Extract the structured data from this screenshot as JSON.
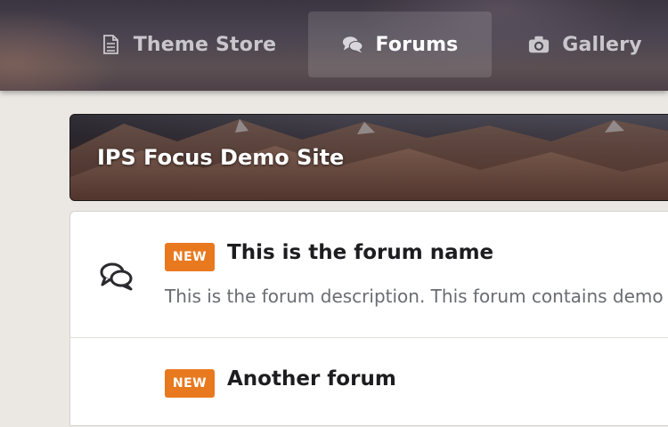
{
  "nav": {
    "items": [
      {
        "label": "Theme Store",
        "icon": "document-icon",
        "active": false
      },
      {
        "label": "Forums",
        "icon": "chat-bubbles-icon",
        "active": true
      },
      {
        "label": "Gallery",
        "icon": "camera-icon",
        "active": false
      }
    ]
  },
  "hero": {
    "title": "IPS Focus Demo Site"
  },
  "forums": [
    {
      "badge": "NEW",
      "name": "This is the forum name",
      "description": "This is the forum description. This forum contains demo t",
      "icon": "chat-bubbles-icon"
    },
    {
      "badge": "NEW",
      "name": "Another forum"
    }
  ],
  "colors": {
    "accent": "#e8791f",
    "background": "#ebe7e3",
    "nav_active_text": "#ffffff",
    "nav_text": "#c9c6cc"
  }
}
